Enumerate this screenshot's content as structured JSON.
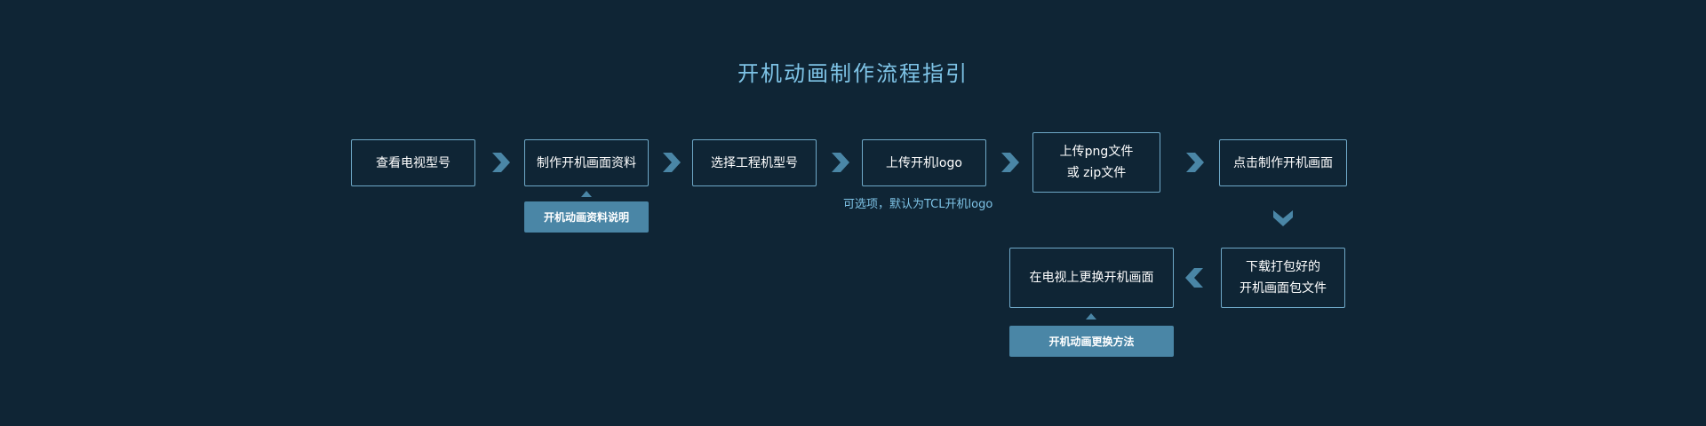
{
  "title": "开机动画制作流程指引",
  "steps": [
    {
      "label": "查看电视型号"
    },
    {
      "label": "制作开机画面资料"
    },
    {
      "label": "选择工程机型号"
    },
    {
      "label": "上传开机logo"
    },
    {
      "label": "上传png文件\n或 zip文件"
    },
    {
      "label": "点击制作开机画面"
    },
    {
      "label": "下载打包好的\n开机画面包文件"
    },
    {
      "label": "在电视上更换开机画面"
    }
  ],
  "notes": {
    "materials_guide": "开机动画资料说明",
    "logo_optional": "可选项，默认为TCL开机logo",
    "replace_method": "开机动画更换方法"
  },
  "colors": {
    "background": "#0f2535",
    "accent": "#7ec3e6",
    "border": "#6fa9c8",
    "arrow": "#4a86a6",
    "button": "#4a86a6"
  },
  "icons": {
    "flow_arrow": "chevron-right-icon",
    "down_arrow": "chevron-down-icon",
    "back_arrow": "chevron-left-icon"
  }
}
